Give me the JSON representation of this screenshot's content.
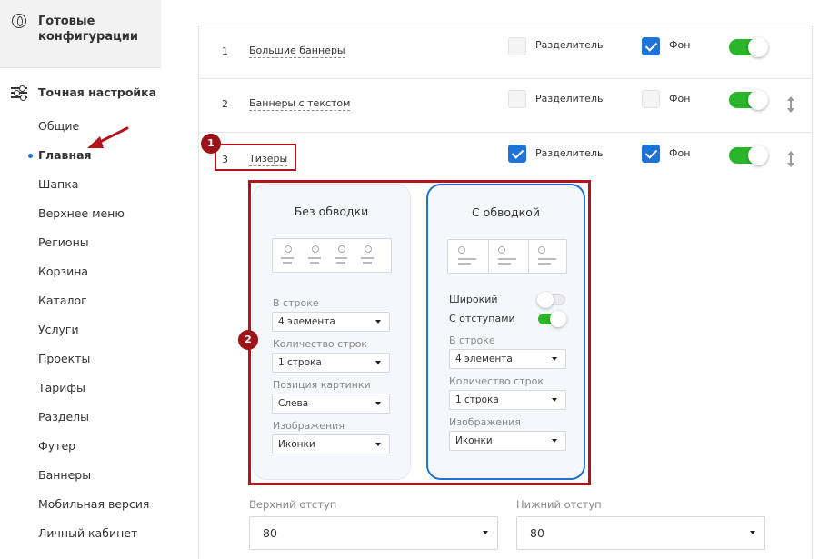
{
  "sidebar": {
    "ready_configs": "Готовые конфигурации",
    "fine_tuning": "Точная настройка",
    "items": [
      "Общие",
      "Главная",
      "Шапка",
      "Верхнее меню",
      "Регионы",
      "Корзина",
      "Каталог",
      "Услуги",
      "Проекты",
      "Тарифы",
      "Разделы",
      "Футер",
      "Баннеры",
      "Мобильная версия",
      "Личный кабинет"
    ],
    "active_index": 1
  },
  "blocks": {
    "separator_label": "Разделитель",
    "background_label": "Фон",
    "rows": [
      {
        "num": "1",
        "name": "Большие баннеры",
        "separator": false,
        "background": true,
        "enabled": true
      },
      {
        "num": "2",
        "name": "Баннеры с текстом",
        "separator": false,
        "background": false,
        "enabled": true
      },
      {
        "num": "3",
        "name": "Тизеры",
        "separator": true,
        "background": true,
        "enabled": true
      }
    ]
  },
  "annotations": {
    "badge1": "1",
    "badge2": "2"
  },
  "variants": {
    "plain": {
      "title": "Без обводки",
      "per_row_label": "В строке",
      "per_row_value": "4 элемента",
      "rows_label": "Количество строк",
      "rows_value": "1 строка",
      "image_pos_label": "Позиция картинки",
      "image_pos_value": "Слева",
      "images_label": "Изображения",
      "images_value": "Иконки"
    },
    "bordered": {
      "title": "С обводкой",
      "wide_label": "Широкий",
      "wide_on": false,
      "padding_label": "С отступами",
      "padding_on": true,
      "per_row_label": "В строке",
      "per_row_value": "4 элемента",
      "rows_label": "Количество строк",
      "rows_value": "1 строка",
      "images_label": "Изображения",
      "images_value": "Иконки"
    }
  },
  "margins": {
    "top_label": "Верхний отступ",
    "top_value": "80",
    "bottom_label": "Нижний отступ",
    "bottom_value": "80"
  },
  "colors": {
    "accent": "#1e73d6",
    "toggle_on": "#2bb52b",
    "annotation": "#b3141c"
  }
}
